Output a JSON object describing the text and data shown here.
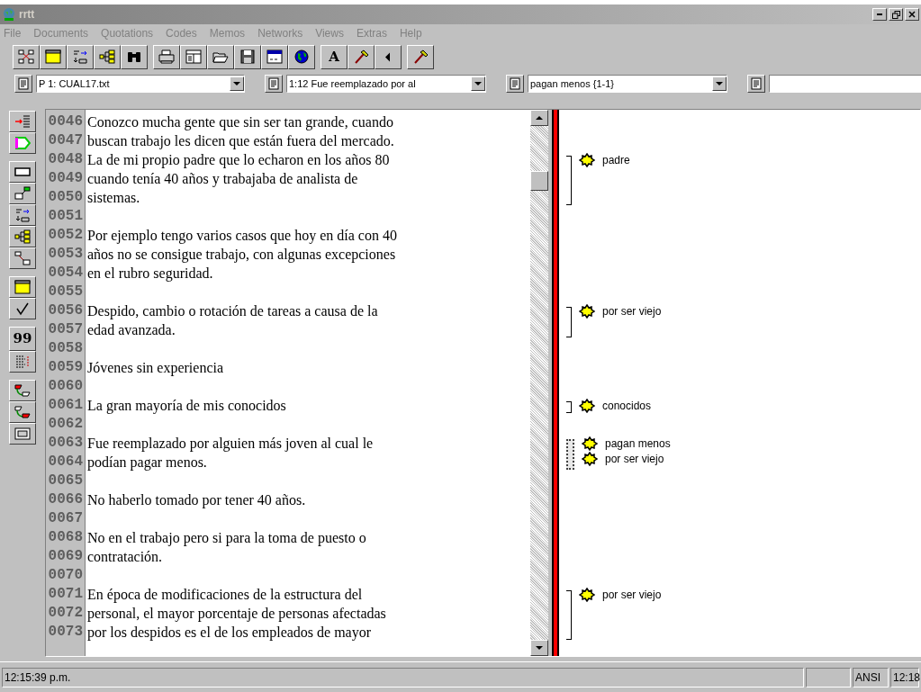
{
  "window": {
    "title": "rrtt"
  },
  "menu": [
    {
      "label": "File",
      "disabled": true
    },
    {
      "label": "Documents",
      "disabled": true
    },
    {
      "label": "Quotations",
      "disabled": true
    },
    {
      "label": "Codes",
      "disabled": true
    },
    {
      "label": "Memos",
      "disabled": true
    },
    {
      "label": "Networks",
      "disabled": true
    },
    {
      "label": "Views",
      "disabled": true
    },
    {
      "label": "Extras",
      "disabled": true
    },
    {
      "label": "Help",
      "disabled": true
    }
  ],
  "toolbar": [
    {
      "kind": "network"
    },
    {
      "kind": "window"
    },
    {
      "kind": "import"
    },
    {
      "kind": "tree"
    },
    {
      "kind": "binoculars"
    },
    {
      "kind": "gap"
    },
    {
      "kind": "printer"
    },
    {
      "kind": "layout"
    },
    {
      "kind": "open"
    },
    {
      "kind": "save"
    },
    {
      "kind": "dialog"
    },
    {
      "kind": "globe"
    },
    {
      "kind": "gap"
    },
    {
      "kind": "letter",
      "text": "A"
    },
    {
      "kind": "hammer"
    },
    {
      "kind": "back"
    },
    {
      "kind": "gap"
    },
    {
      "kind": "hammer"
    }
  ],
  "selectors": [
    {
      "value": "P 1: CUAL17.txt"
    },
    {
      "value": "1:12 Fue reemplazado por al"
    },
    {
      "value": "pagan menos {1-1}"
    }
  ],
  "side_toolbar": [
    {
      "kind": "mark"
    },
    {
      "kind": "tag"
    },
    {
      "kind": "gap"
    },
    {
      "kind": "rect"
    },
    {
      "kind": "note"
    },
    {
      "kind": "import"
    },
    {
      "kind": "tree"
    },
    {
      "kind": "link"
    },
    {
      "kind": "gap"
    },
    {
      "kind": "window"
    },
    {
      "kind": "check"
    },
    {
      "kind": "gap"
    },
    {
      "kind": "label",
      "text": "99"
    },
    {
      "kind": "list"
    },
    {
      "kind": "gap"
    },
    {
      "kind": "link_red"
    },
    {
      "kind": "link_green"
    },
    {
      "kind": "monitor"
    }
  ],
  "segments": [
    {
      "lines": [
        {
          "number": "0046",
          "text": "Conozco mucha gente que sin ser tan grande, cuando"
        },
        {
          "number": "0047",
          "text": "buscan trabajo les dicen que están fuera del mercado."
        }
      ]
    },
    {
      "selected": false,
      "codes": [
        {
          "label": "padre"
        }
      ],
      "lines": [
        {
          "number": "0048",
          "text": "La de mi propio padre que lo echaron en los años 80"
        },
        {
          "number": "0049",
          "text": "cuando tenía 40 años y trabajaba de analista de"
        },
        {
          "number": "0050",
          "text": "sistemas."
        }
      ]
    },
    {
      "lines": [
        {
          "number": "0051"
        },
        {
          "number": "0052",
          "text": "Por ejemplo tengo varios casos que hoy en día con 40"
        },
        {
          "number": "0053",
          "text": "años no se consigue trabajo, con algunas excepciones"
        },
        {
          "number": "0054",
          "text": "en el rubro seguridad."
        },
        {
          "number": "0055"
        }
      ]
    },
    {
      "selected": false,
      "codes": [
        {
          "label": "por ser viejo"
        }
      ],
      "lines": [
        {
          "number": "0056",
          "text": "Despido, cambio o rotación de tareas a causa de la"
        },
        {
          "number": "0057",
          "text": "edad avanzada."
        }
      ]
    },
    {
      "lines": [
        {
          "number": "0058"
        },
        {
          "number": "0059",
          "text": "Jóvenes sin experiencia"
        },
        {
          "number": "0060"
        }
      ]
    },
    {
      "selected": false,
      "codes": [
        {
          "label": "conocidos"
        }
      ],
      "lines": [
        {
          "number": "0061",
          "text": "La gran mayoría de mis conocidos"
        }
      ]
    },
    {
      "lines": [
        {
          "number": "0062"
        }
      ]
    },
    {
      "selected": true,
      "codes": [
        {
          "label": "pagan menos"
        },
        {
          "label": "por ser viejo"
        }
      ],
      "lines": [
        {
          "number": "0063",
          "text": "Fue reemplazado por alguien más joven al cual le"
        },
        {
          "number": "0064",
          "text": "podían pagar menos."
        }
      ]
    },
    {
      "lines": [
        {
          "number": "0065"
        },
        {
          "number": "0066",
          "text": "No haberlo tomado por tener 40 años."
        },
        {
          "number": "0067"
        },
        {
          "number": "0068",
          "text": "No en el trabajo pero si para la toma de puesto o"
        },
        {
          "number": "0069",
          "text": "contratación."
        },
        {
          "number": "0070"
        }
      ]
    },
    {
      "selected": false,
      "codes": [
        {
          "label": "por ser viejo"
        }
      ],
      "lines": [
        {
          "number": "0071",
          "text": "En época de modificaciones de la estructura del"
        },
        {
          "number": "0072",
          "text": "personal, el mayor porcentaje de personas afectadas"
        },
        {
          "number": "0073",
          "text": "por los despidos es el de los empleados de mayor"
        }
      ]
    }
  ],
  "status_bar": [
    {
      "text": "12:15:39 p.m."
    },
    {
      "text": "ANSI"
    },
    {
      "text": "12:18"
    }
  ]
}
